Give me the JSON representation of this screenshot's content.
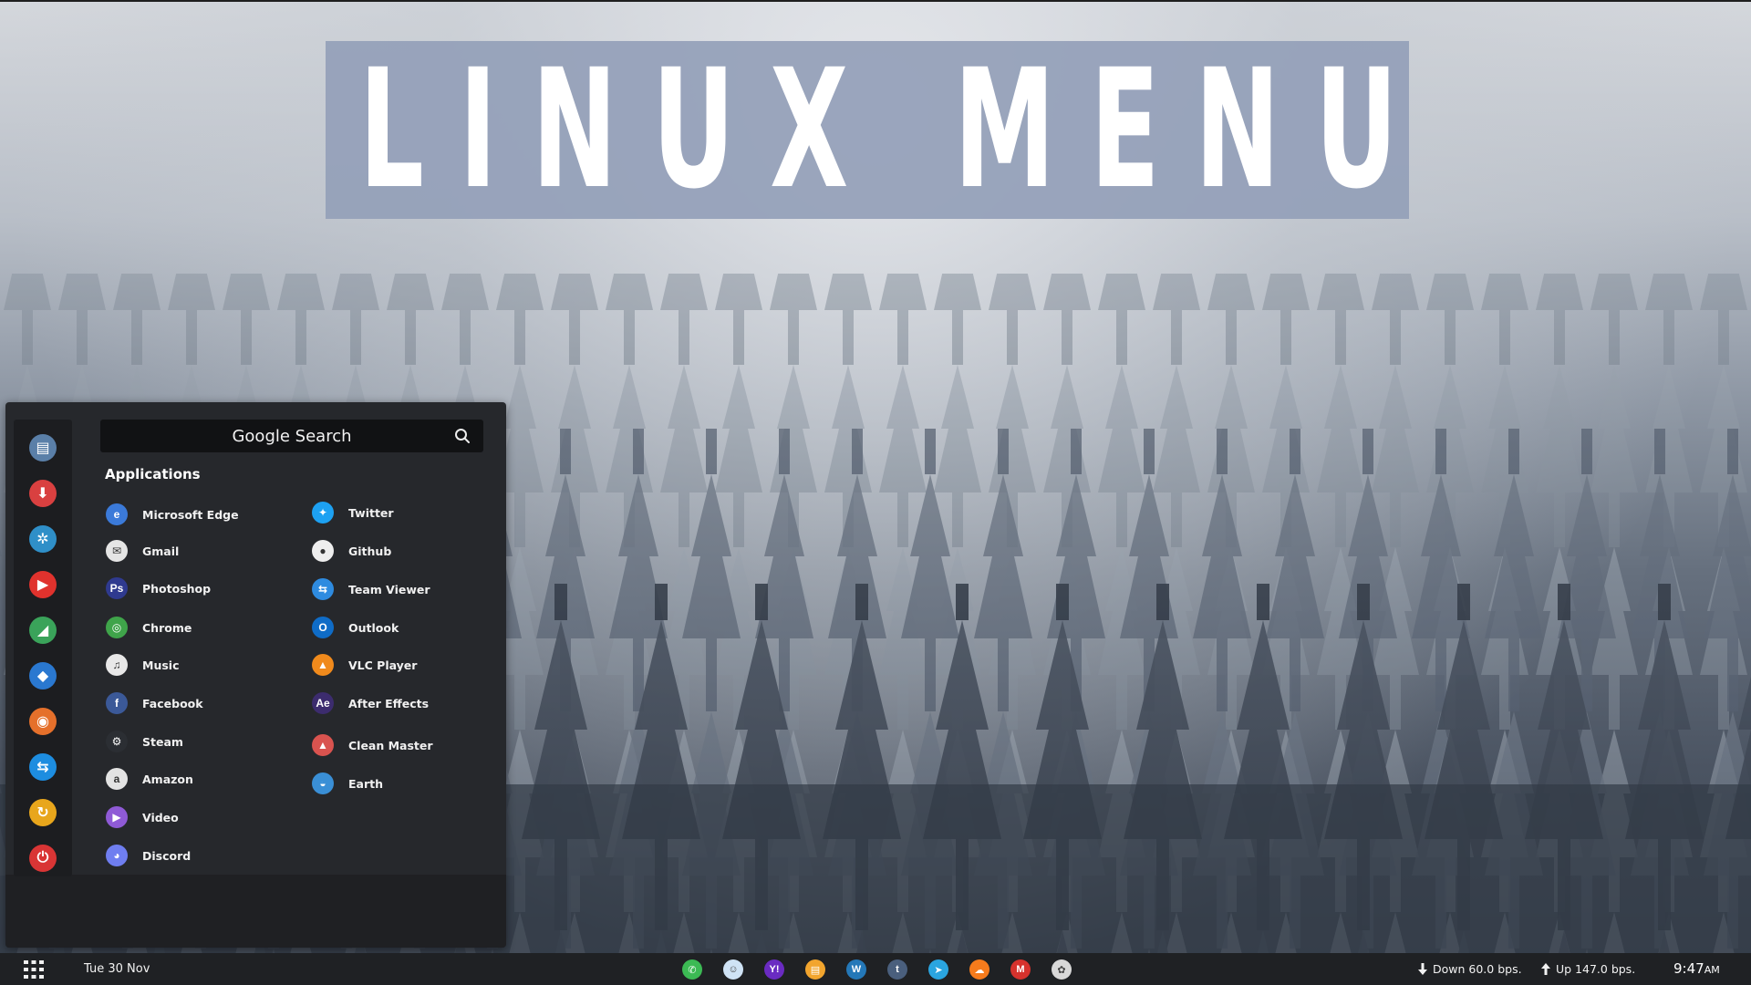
{
  "banner": {
    "title": "LINUX MENU"
  },
  "menu": {
    "search": {
      "placeholder": "Google Search"
    },
    "section_title": "Applications",
    "sidebar_items": [
      {
        "name": "files",
        "color": "#5a7fa8",
        "glyph": "▤"
      },
      {
        "name": "downloader",
        "color": "#d94040",
        "glyph": "⬇"
      },
      {
        "name": "settings",
        "color": "#2f8fc8",
        "glyph": "✲"
      },
      {
        "name": "youtube",
        "color": "#e0322d",
        "glyph": "▶"
      },
      {
        "name": "maps",
        "color": "#3aa35a",
        "glyph": "◢"
      },
      {
        "name": "dropbox",
        "color": "#2a78d0",
        "glyph": "◆"
      },
      {
        "name": "firefox",
        "color": "#e5702b",
        "glyph": "◉"
      },
      {
        "name": "teamviewer",
        "color": "#1d8de0",
        "glyph": "⇆"
      },
      {
        "name": "sync",
        "color": "#e8a61c",
        "glyph": "↻"
      },
      {
        "name": "power",
        "color": "#d93535",
        "glyph": "⏻"
      }
    ],
    "apps_left": [
      {
        "label": "Microsoft Edge",
        "icon": "edge-icon",
        "color": "#3b7ad9",
        "glyph": "e"
      },
      {
        "label": "Gmail",
        "icon": "gmail-icon",
        "color": "#e5e5e5",
        "glyph": "✉"
      },
      {
        "label": "Photoshop",
        "icon": "photoshop-icon",
        "color": "#2f3a8f",
        "glyph": "Ps"
      },
      {
        "label": "Chrome",
        "icon": "chrome-icon",
        "color": "#3fa44a",
        "glyph": "◎"
      },
      {
        "label": "Music",
        "icon": "music-icon",
        "color": "#e8e8e8",
        "glyph": "♫"
      },
      {
        "label": "Facebook",
        "icon": "facebook-icon",
        "color": "#3b5998",
        "glyph": "f"
      },
      {
        "label": "Steam",
        "icon": "steam-icon",
        "color": "#2b2e33",
        "glyph": "⚙"
      },
      {
        "label": "Amazon",
        "icon": "amazon-icon",
        "color": "#e3e3e3",
        "glyph": "a"
      },
      {
        "label": "Video",
        "icon": "video-icon",
        "color": "#8f5ad6",
        "glyph": "▶"
      },
      {
        "label": "Discord",
        "icon": "discord-icon",
        "color": "#6f7ef0",
        "glyph": "◕"
      }
    ],
    "apps_right": [
      {
        "label": "Twitter",
        "icon": "twitter-icon",
        "color": "#1da1f2",
        "glyph": "✦"
      },
      {
        "label": "Github",
        "icon": "github-icon",
        "color": "#eeeeee",
        "glyph": "●"
      },
      {
        "label": "Team Viewer",
        "icon": "teamviewer-icon",
        "color": "#2e8be0",
        "glyph": "⇆"
      },
      {
        "label": "Outlook",
        "icon": "outlook-icon",
        "color": "#0f6cc7",
        "glyph": "O"
      },
      {
        "label": "VLC Player",
        "icon": "vlc-icon",
        "color": "#f08a1c",
        "glyph": "▲"
      },
      {
        "label": "After Effects",
        "icon": "aftereffects-icon",
        "color": "#3c2c6e",
        "glyph": "Ae"
      },
      {
        "label": "Clean Master",
        "icon": "cleanmaster-icon",
        "color": "#d9534f",
        "glyph": "▲"
      },
      {
        "label": "Earth",
        "icon": "earth-icon",
        "color": "#3a8fd6",
        "glyph": "◒"
      }
    ]
  },
  "taskbar": {
    "date": "Tue 30 Nov",
    "tray": [
      {
        "name": "whatsapp",
        "color": "#3cba54",
        "glyph": "✆"
      },
      {
        "name": "reddit",
        "color": "#cfe3f5",
        "glyph": "☺"
      },
      {
        "name": "yahoo",
        "color": "#6a2bc2",
        "glyph": "Y!"
      },
      {
        "name": "files",
        "color": "#f2a52e",
        "glyph": "▤"
      },
      {
        "name": "wordpress",
        "color": "#2478b8",
        "glyph": "W"
      },
      {
        "name": "tumblr",
        "color": "#4a5f7d",
        "glyph": "t"
      },
      {
        "name": "telegram",
        "color": "#2aa5e0",
        "glyph": "➤"
      },
      {
        "name": "soundcloud",
        "color": "#f67b1c",
        "glyph": "☁"
      },
      {
        "name": "gmail",
        "color": "#d6322d",
        "glyph": "M"
      },
      {
        "name": "picasa",
        "color": "#d8d8d8",
        "glyph": "✿"
      }
    ],
    "net_down": "Down 60.0 bps.",
    "net_up": "Up 147.0 bps.",
    "time": "9:47",
    "ampm": "AM"
  }
}
